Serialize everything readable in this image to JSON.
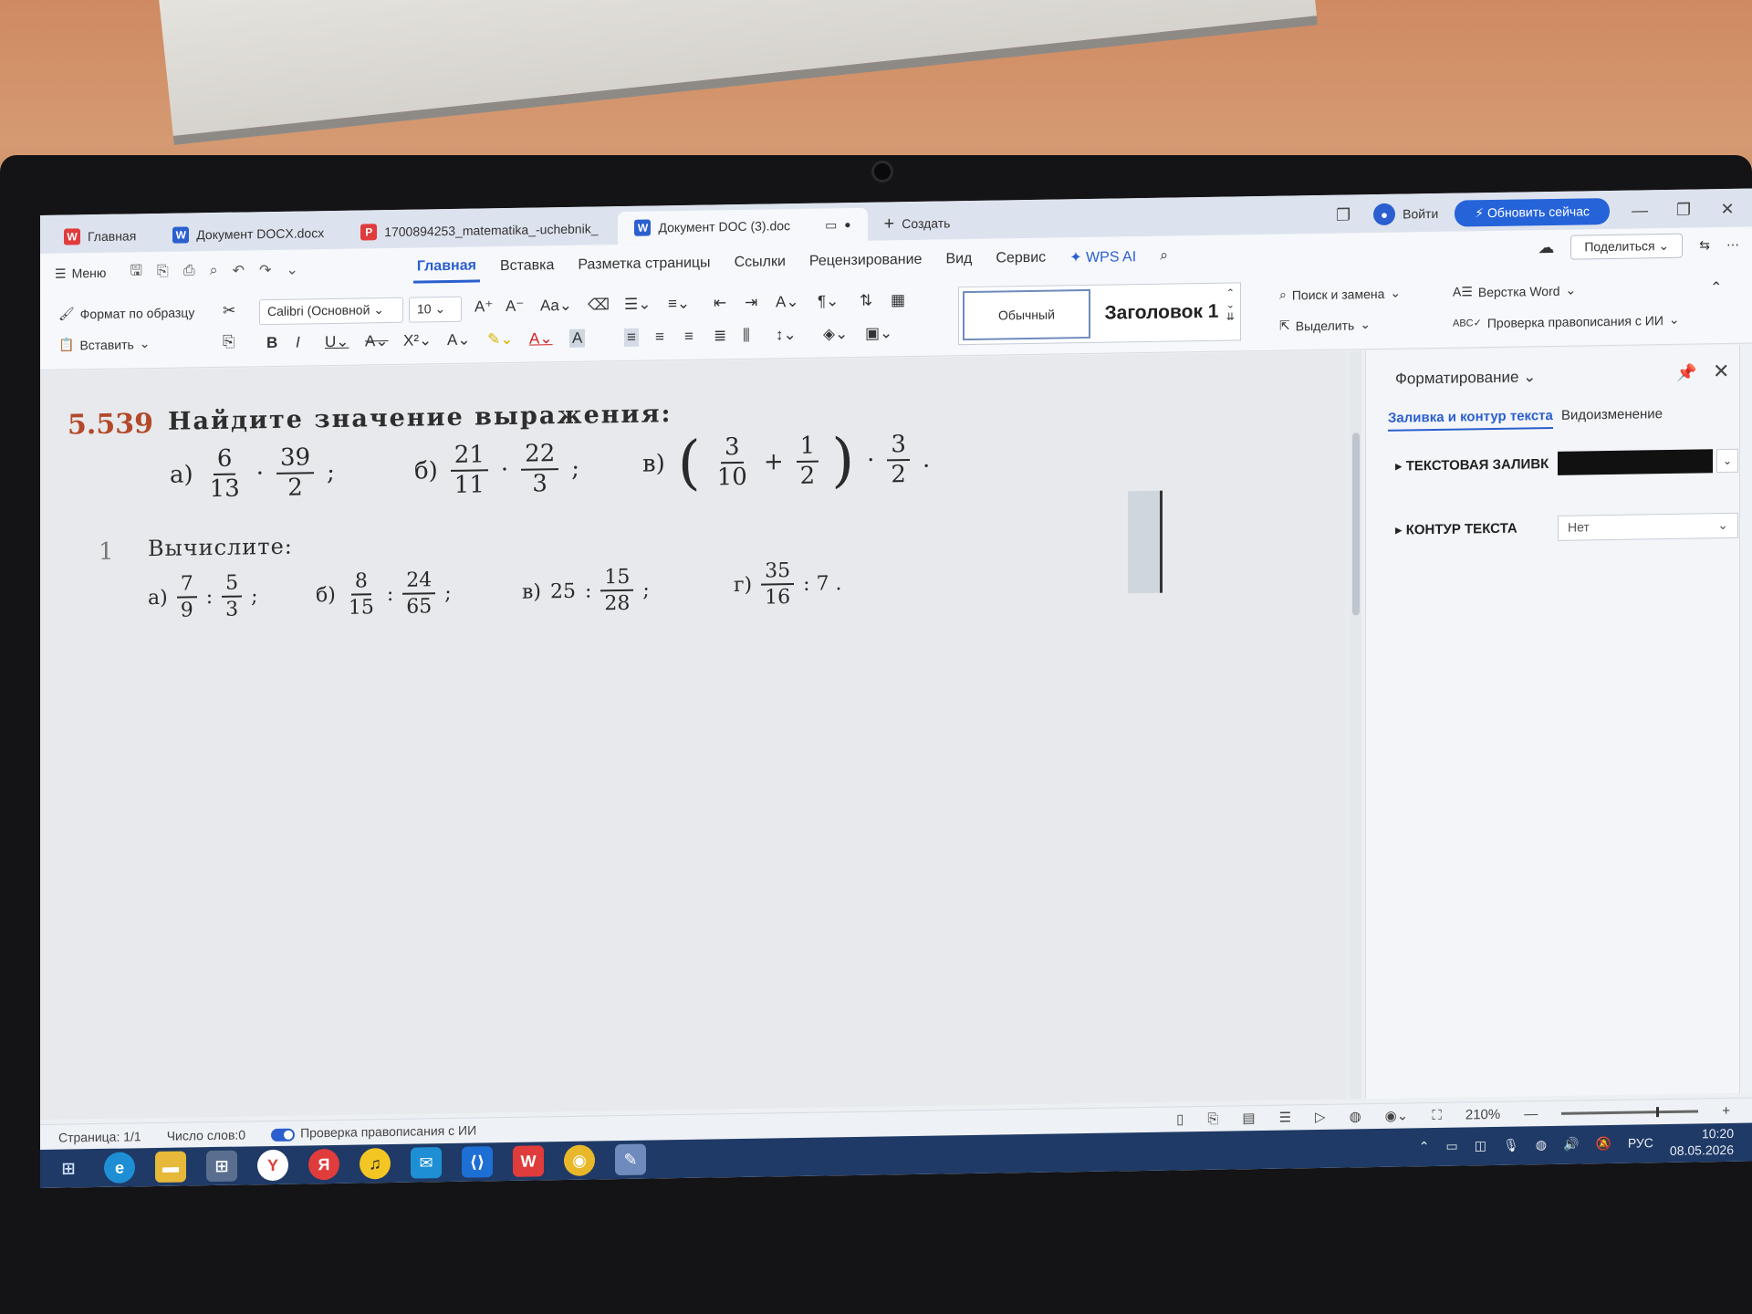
{
  "tabs": [
    {
      "label": "Главная",
      "icon": "wps-icon"
    },
    {
      "label": "Документ DOCX.docx",
      "icon": "word-icon"
    },
    {
      "label": "1700894253_matematika_-uchebnik_",
      "icon": "pdf-icon"
    },
    {
      "label": "Документ DOC (3).doc",
      "icon": "word-icon"
    }
  ],
  "create_label": "Создать",
  "login_label": "Войти",
  "update_label": "Обновить сейчас",
  "menu_label": "Меню",
  "ribbon_tabs": [
    "Главная",
    "Вставка",
    "Разметка страницы",
    "Ссылки",
    "Рецензирование",
    "Вид",
    "Сервис",
    "WPS AI"
  ],
  "share_label": "Поделиться",
  "ribbon": {
    "format_painter": "Формат по образцу",
    "paste": "Вставить",
    "font": "Calibri (Основной",
    "size": "10",
    "style_normal": "Обычный",
    "style_heading": "Заголовок 1",
    "find_replace": "Поиск и замена",
    "select": "Выделить",
    "layout_word": "Верстка Word",
    "spellcheck_ai": "Проверка правописания с ИИ"
  },
  "doc": {
    "problem_number": "5.539",
    "problem_title": "Найдите значение выражения:",
    "part_a_label": "а)",
    "part_b_label": "б)",
    "part_c_label": "в)",
    "a_f1_n": "6",
    "a_f1_d": "13",
    "a_op": "·",
    "a_f2_n": "39",
    "a_f2_d": "2",
    "a_end": ";",
    "b_f1_n": "21",
    "b_f1_d": "11",
    "b_op": "·",
    "b_f2_n": "22",
    "b_f2_d": "3",
    "b_end": ";",
    "c_f1_n": "3",
    "c_f1_d": "10",
    "c_plus": "+",
    "c_f2_n": "1",
    "c_f2_d": "2",
    "c_op": "·",
    "c_f3_n": "3",
    "c_f3_d": "2",
    "c_end": ".",
    "sub_number": "1",
    "sub_title": "Вычислите:",
    "s_a_label": "а)",
    "s_a_f1_n": "7",
    "s_a_f1_d": "9",
    "s_a_op": ":",
    "s_a_f2_n": "5",
    "s_a_f2_d": "3",
    "s_a_end": ";",
    "s_b_label": "б)",
    "s_b_f1_n": "8",
    "s_b_f1_d": "15",
    "s_b_op": ":",
    "s_b_f2_n": "24",
    "s_b_f2_d": "65",
    "s_b_end": ";",
    "s_c_label": "в)",
    "s_c_int": "25",
    "s_c_op": ":",
    "s_c_f_n": "15",
    "s_c_f_d": "28",
    "s_c_end": ";",
    "s_d_label": "г)",
    "s_d_f_n": "35",
    "s_d_f_d": "16",
    "s_d_rest": ": 7 ."
  },
  "sidepane": {
    "title": "Форматирование",
    "tab_fill": "Заливка и контур текста",
    "tab_transform": "Видоизменение",
    "text_fill": "ТЕКСТОВАЯ ЗАЛИВК",
    "text_outline": "КОНТУР ТЕКСТА",
    "outline_value": "Нет"
  },
  "status": {
    "page": "Страница: 1/1",
    "words": "Число слов:0",
    "spell": "Проверка правописания с ИИ",
    "zoom": "210%"
  },
  "taskbar": {
    "lang": "РУС",
    "time": "10:20",
    "date": "08.05.2026"
  }
}
